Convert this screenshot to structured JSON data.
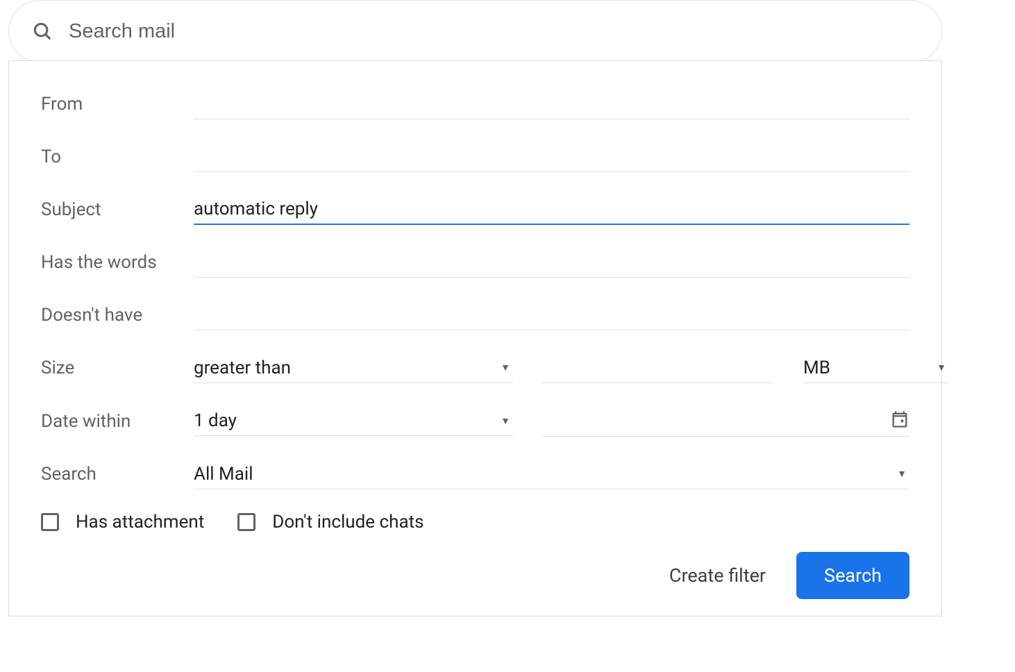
{
  "search": {
    "placeholder": "Search mail",
    "value": ""
  },
  "form": {
    "from_label": "From",
    "from_value": "",
    "to_label": "To",
    "to_value": "",
    "subject_label": "Subject",
    "subject_value": "automatic reply",
    "haswords_label": "Has the words",
    "haswords_value": "",
    "doesnthave_label": "Doesn't have",
    "doesnthave_value": "",
    "size_label": "Size",
    "size_comparator": "greater than",
    "size_value": "",
    "size_unit": "MB",
    "date_label": "Date within",
    "date_range": "1 day",
    "date_value": "",
    "searchin_label": "Search",
    "searchin_value": "All Mail",
    "has_attachment_label": "Has attachment",
    "dont_include_chats_label": "Don't include chats"
  },
  "actions": {
    "create_filter": "Create filter",
    "search": "Search"
  }
}
